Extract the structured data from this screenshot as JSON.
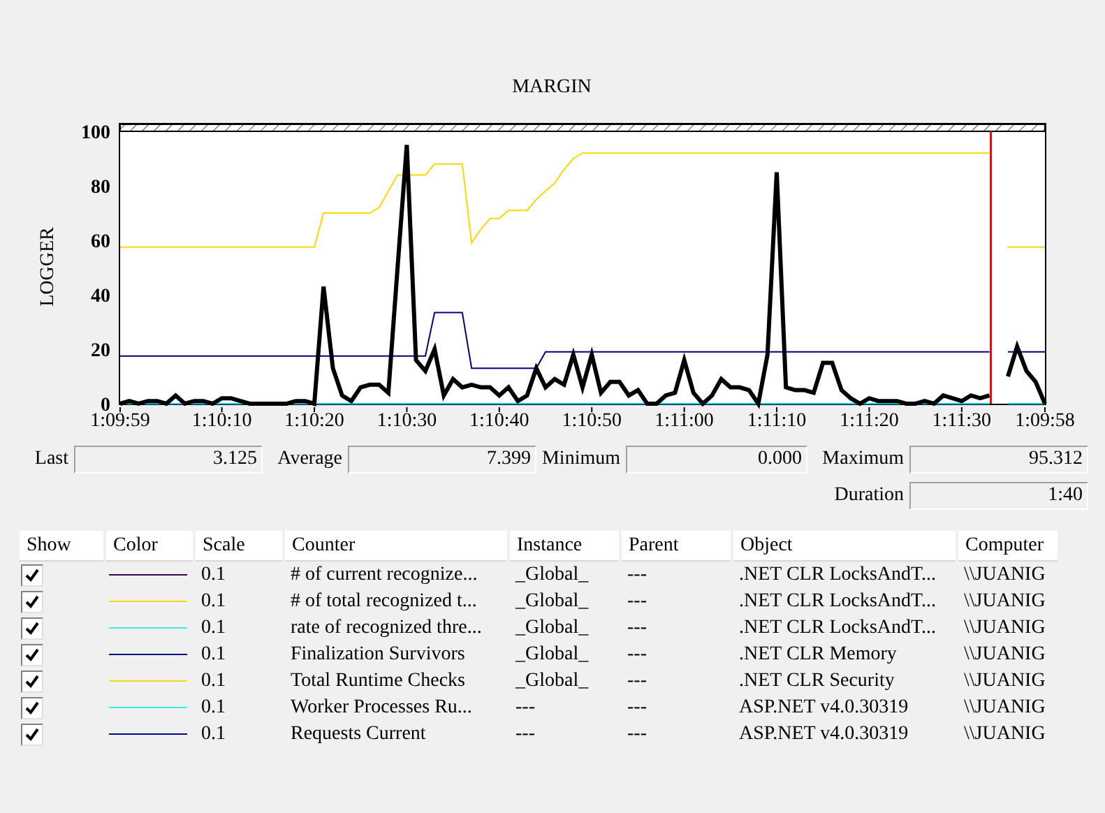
{
  "chart": {
    "chart_data": {
      "type": "line",
      "title": "MARGIN",
      "ylabel": "LOGGER",
      "categories": [
        "1:09:59",
        null,
        null,
        null,
        null,
        null,
        null,
        null,
        null,
        null,
        null,
        "1:10:10",
        null,
        null,
        null,
        null,
        null,
        null,
        null,
        null,
        null,
        "1:10:20",
        null,
        null,
        null,
        null,
        null,
        null,
        null,
        null,
        null,
        "1:10:30",
        null,
        null,
        null,
        null,
        null,
        null,
        null,
        null,
        null,
        "1:10:40",
        null,
        null,
        null,
        null,
        null,
        null,
        null,
        null,
        null,
        "1:10:50",
        null,
        null,
        null,
        null,
        null,
        null,
        null,
        null,
        null,
        "1:11:00",
        null,
        null,
        null,
        null,
        null,
        null,
        null,
        null,
        null,
        "1:11:10",
        null,
        null,
        null,
        null,
        null,
        null,
        null,
        null,
        null,
        "1:11:20",
        null,
        null,
        null,
        null,
        null,
        null,
        null,
        null,
        null,
        "1:11:30",
        null,
        null,
        null,
        null,
        null,
        null,
        null,
        null,
        "1:09:58"
      ],
      "ylim": [
        0,
        100
      ],
      "yticks": [
        0,
        20,
        40,
        60,
        80,
        100
      ],
      "series": [
        {
          "color": "#ffd700",
          "values": [
            57.5,
            57.5,
            57.5,
            57.5,
            57.5,
            57.5,
            57.5,
            57.5,
            57.5,
            57.5,
            57.5,
            57.5,
            57.5,
            57.5,
            57.5,
            57.5,
            57.5,
            57.5,
            57.5,
            57.5,
            57.5,
            57.5,
            70,
            70,
            70,
            70,
            70,
            70,
            72,
            78,
            84,
            84,
            84,
            84,
            88,
            88,
            88,
            88,
            59,
            64,
            68,
            68,
            71,
            71,
            71,
            75,
            78,
            81,
            86,
            90,
            92,
            92,
            92,
            92,
            92,
            92,
            92,
            92,
            92,
            92,
            92,
            92,
            92,
            92,
            92,
            92,
            92,
            92,
            92,
            92,
            92,
            92,
            92,
            92,
            92,
            92,
            92,
            92,
            92,
            92,
            92,
            92,
            92,
            92,
            92,
            92,
            92,
            92,
            92,
            92,
            92,
            92,
            92,
            92,
            92,
            null,
            57.5,
            57.5,
            57.5,
            57.5,
            57.5
          ]
        },
        {
          "color": "#000080",
          "values": [
            17.5,
            17.5,
            17.5,
            17.5,
            17.5,
            17.5,
            17.5,
            17.5,
            17.5,
            17.5,
            17.5,
            17.5,
            17.5,
            17.5,
            17.5,
            17.5,
            17.5,
            17.5,
            17.5,
            17.5,
            17.5,
            17.5,
            17.5,
            17.5,
            17.5,
            17.5,
            17.5,
            17.5,
            17.5,
            17.5,
            17.5,
            17.5,
            17.5,
            17.5,
            33.5,
            33.5,
            33.5,
            33.5,
            13,
            13,
            13,
            13,
            13,
            13,
            13,
            13,
            19,
            19,
            19,
            19,
            19,
            19,
            19,
            19,
            19,
            19,
            19,
            19,
            19,
            19,
            19,
            19,
            19,
            19,
            19,
            19,
            19,
            19,
            19,
            19,
            19,
            19,
            19,
            19,
            19,
            19,
            19,
            19,
            19,
            19,
            19,
            19,
            19,
            19,
            19,
            19,
            19,
            19,
            19,
            19,
            19,
            19,
            19,
            19,
            19,
            null,
            19,
            19,
            19,
            19,
            19
          ]
        },
        {
          "color": "#00c8f0",
          "values": [
            0,
            0,
            0,
            0,
            0,
            0,
            0,
            0,
            0,
            0,
            0,
            0,
            0,
            0,
            0,
            0,
            0,
            0,
            0,
            0,
            0,
            0,
            0,
            0,
            0,
            0,
            0,
            0,
            0,
            0,
            0,
            0,
            0,
            0,
            0,
            0,
            0,
            0,
            0,
            0,
            0,
            0,
            0,
            0,
            0,
            0,
            0,
            0,
            0,
            0,
            0,
            0,
            0,
            0,
            0,
            0,
            0,
            0,
            0,
            0,
            0,
            0,
            0,
            0,
            0,
            0,
            0,
            0,
            0,
            0,
            0,
            0,
            0,
            0,
            0,
            0,
            0,
            0,
            0,
            0,
            0,
            0,
            0,
            0,
            0,
            0,
            0,
            0,
            0,
            0,
            0,
            0,
            0,
            0,
            0,
            null,
            0,
            0,
            0,
            0,
            0
          ]
        },
        {
          "color": "#000000",
          "values": [
            0,
            1,
            0,
            1,
            1,
            0,
            3,
            0,
            1,
            1,
            0,
            2,
            2,
            1,
            0,
            0,
            0,
            0,
            0,
            1,
            1,
            0,
            43,
            13,
            3,
            1,
            6,
            7,
            7,
            4,
            50,
            95,
            16,
            12,
            20,
            3,
            9,
            6,
            7,
            6,
            6,
            3,
            6,
            1,
            3,
            13,
            6,
            9,
            7,
            18,
            6,
            18,
            4,
            8,
            8,
            3,
            5,
            0,
            0,
            3,
            4,
            16,
            4,
            0,
            3,
            9,
            6,
            6,
            5,
            0,
            18,
            85,
            6,
            5,
            5,
            4,
            15,
            15,
            5,
            2,
            0,
            2,
            1,
            1,
            1,
            0,
            0,
            1,
            0,
            3,
            2,
            1,
            3,
            2,
            3,
            null,
            10,
            21,
            12,
            8,
            0
          ]
        }
      ]
    }
  },
  "statistics": [
    {
      "label": "Last",
      "value": "3.125"
    },
    {
      "label": "Average",
      "value": "7.399"
    },
    {
      "label": "Minimum",
      "value": "0.000"
    },
    {
      "label": "Maximum",
      "value": "95.312"
    },
    {
      "label": "Duration",
      "value": "1:40"
    }
  ],
  "table": {
    "columns": [
      "Show",
      "Color",
      "Scale",
      "Counter",
      "Instance",
      "Parent",
      "Object",
      "Computer"
    ],
    "rows": [
      {
        "checked": true,
        "color": "#400050",
        "scale": "0.1",
        "counter": "# of current recognize...",
        "instance": "_Global_",
        "parent": "---",
        "object": ".NET CLR LocksAndT...",
        "computer": "\\\\JUANIG"
      },
      {
        "checked": true,
        "color": "#ffd700",
        "scale": "0.1",
        "counter": "# of total recognized t...",
        "instance": "_Global_",
        "parent": "---",
        "object": ".NET CLR LocksAndT...",
        "computer": "\\\\JUANIG"
      },
      {
        "checked": true,
        "color": "#40e8f0",
        "scale": "0.1",
        "counter": "rate of recognized thre...",
        "instance": "_Global_",
        "parent": "---",
        "object": ".NET CLR LocksAndT...",
        "computer": "\\\\JUANIG"
      },
      {
        "checked": true,
        "color": "#000080",
        "scale": "0.1",
        "counter": "Finalization Survivors",
        "instance": "_Global_",
        "parent": "---",
        "object": ".NET CLR Memory",
        "computer": "\\\\JUANIG"
      },
      {
        "checked": true,
        "color": "#ffd700",
        "scale": "0.1",
        "counter": "Total Runtime Checks",
        "instance": "_Global_",
        "parent": "---",
        "object": ".NET CLR Security",
        "computer": "\\\\JUANIG"
      },
      {
        "checked": true,
        "color": "#40e8f0",
        "scale": "0.1",
        "counter": "Worker Processes Ru...",
        "instance": "---",
        "parent": "---",
        "object": "ASP.NET v4.0.30319",
        "computer": "\\\\JUANIG"
      },
      {
        "checked": true,
        "color": "#000080",
        "scale": "0.1",
        "counter": "Requests Current",
        "instance": "---",
        "parent": "---",
        "object": "ASP.NET v4.0.30319",
        "computer": "\\\\JUANIG"
      }
    ]
  }
}
